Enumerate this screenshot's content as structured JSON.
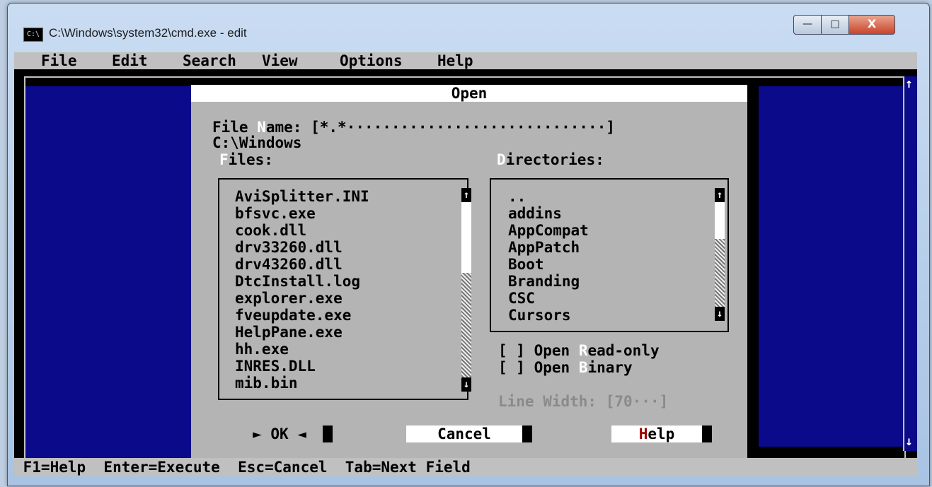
{
  "window": {
    "title": "C:\\Windows\\system32\\cmd.exe - edit",
    "icon_label": "C:\\",
    "minimize_glyph": "—",
    "maximize_glyph": "□",
    "close_glyph": "X"
  },
  "menubar": {
    "items": [
      "File",
      "Edit",
      "Search",
      "View",
      "Options",
      "Help"
    ]
  },
  "dialog": {
    "title": "Open",
    "file_name_label_pre": "File ",
    "file_name_label_hot": "N",
    "file_name_label_post": "ame:",
    "file_name_value": "[*.*·····························]",
    "current_path": "C:\\Windows",
    "files_label_hot": "F",
    "files_label_post": "iles:",
    "dirs_label_hot": "D",
    "dirs_label_post": "irectories:",
    "files": [
      "AviSplitter.INI",
      "bfsvc.exe",
      "cook.dll",
      "drv33260.dll",
      "drv43260.dll",
      "DtcInstall.log",
      "explorer.exe",
      "fveupdate.exe",
      "HelpPane.exe",
      "hh.exe",
      "INRES.DLL",
      "mib.bin"
    ],
    "directories": [
      "..",
      "addins",
      "AppCompat",
      "AppPatch",
      "Boot",
      "Branding",
      "CSC",
      "Cursors"
    ],
    "readonly_checkbox": "[ ]",
    "readonly_pre": "Open ",
    "readonly_hot": "R",
    "readonly_post": "ead-only",
    "binary_checkbox": "[ ]",
    "binary_pre": "Open ",
    "binary_hot": "B",
    "binary_post": "inary",
    "line_width_label": "Line Width:",
    "line_width_value": "[70···]",
    "ok_label": "► OK ◄",
    "cancel_label": "Cancel",
    "help_hot": "H",
    "help_post": "elp",
    "scroll_up": "↑",
    "scroll_down": "↓"
  },
  "statusbar": {
    "text": " F1=Help  Enter=Execute  Esc=Cancel  Tab=Next Field"
  },
  "editor": {
    "scroll_up": "↑",
    "scroll_down": "↓"
  },
  "colors": {
    "editor_bg": "#0a0a8a",
    "dialog_bg": "#b4b4b4",
    "menu_bg": "#c0c0c0",
    "hotkey_red": "#a00000"
  }
}
